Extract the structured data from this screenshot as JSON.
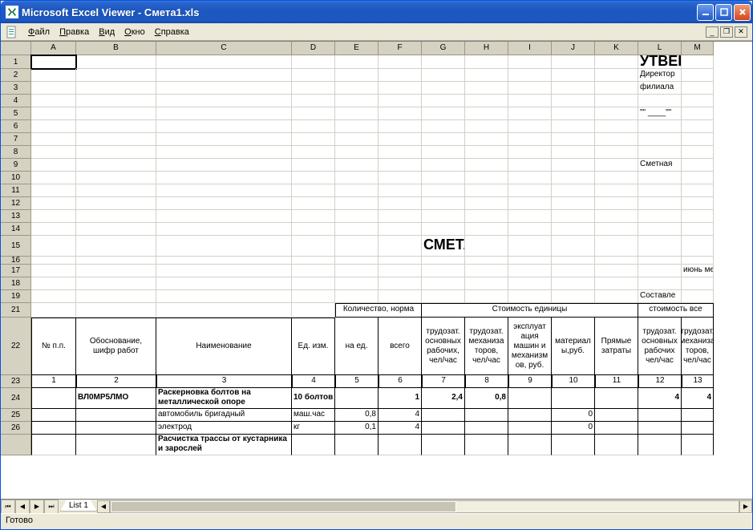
{
  "window": {
    "title": "Microsoft Excel Viewer - Смета1.xls"
  },
  "menus": {
    "file": "Файл",
    "edit": "Правка",
    "view": "Вид",
    "window": "Окно",
    "help": "Справка"
  },
  "columns": [
    "A",
    "B",
    "C",
    "D",
    "E",
    "F",
    "G",
    "H",
    "I",
    "J",
    "K",
    "L",
    "M"
  ],
  "rows": [
    "1",
    "2",
    "3",
    "4",
    "5",
    "6",
    "7",
    "8",
    "9",
    "10",
    "11",
    "12",
    "13",
    "14",
    "15",
    "17",
    "16",
    "18",
    "19",
    "21",
    "22",
    "23",
    "24",
    "25",
    "26"
  ],
  "content": {
    "L1": "УТВЕР",
    "L2": "Директор",
    "L3": "филиала",
    "L5": "\"\" ____\"\"",
    "L9": "Сметная",
    "title": "СМЕТА",
    "M17": "июнь ме",
    "L19": "Составле"
  },
  "header": {
    "qty_group": "Количество, норма",
    "cost_group": "Стоимость единицы",
    "total_group": "стоимость все",
    "npp": "№ п.п.",
    "basis": "Обоснование, шифр работ",
    "name": "Наименование",
    "unit": "Ед. изм.",
    "per_unit": "на ед.",
    "total": "всего",
    "lab_main": "трудозат. основных рабочих, чел/час",
    "lab_mech": "трудозат. механиза торов, чел/час",
    "exploit": "эксплуат ация машин и механизм ов, руб.",
    "materials": "материал ы,руб.",
    "direct": "Прямые затраты",
    "lab_main2": "трудозат. основных рабочих чел/час",
    "lab_mech2": "трудозат. механиза торов, чел/час"
  },
  "numrow": [
    "1",
    "2",
    "3",
    "4",
    "5",
    "6",
    "7",
    "8",
    "9",
    "10",
    "11",
    "12",
    "13"
  ],
  "data": {
    "r24": {
      "B": "ВЛ0МР5ЛМО",
      "C": "Раскерновка болтов на металлической опоре",
      "D": "10 болтов",
      "F": "1",
      "G": "2,4",
      "H": "0,8",
      "L": "4",
      "M": "4"
    },
    "r25": {
      "C": "автомобиль бригадный",
      "D": "маш.час",
      "E": "0,8",
      "F": "4",
      "J": "0"
    },
    "r26": {
      "C": "электрод",
      "D": "кг",
      "E": "0,1",
      "F": "4",
      "J": "0"
    },
    "r27": {
      "C": "Расчистка трассы от кустарника и зарослей"
    }
  },
  "tab": "List 1",
  "status": "Готово"
}
